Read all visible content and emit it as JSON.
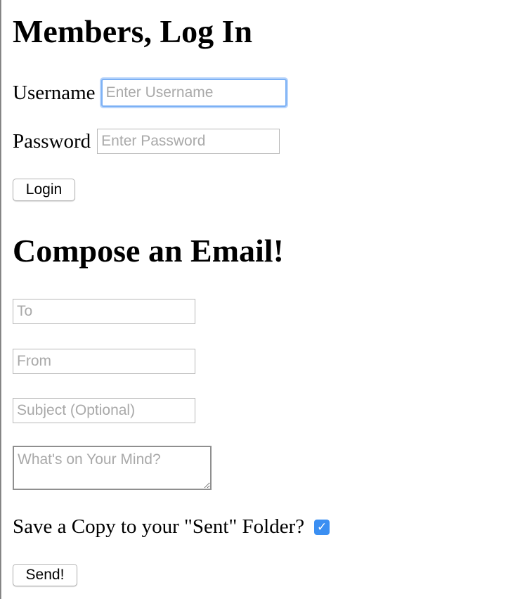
{
  "login": {
    "title": "Members, Log In",
    "username_label": "Username",
    "username_placeholder": "Enter Username",
    "password_label": "Password",
    "password_placeholder": "Enter Password",
    "login_button": "Login"
  },
  "compose": {
    "title": "Compose an Email!",
    "to_placeholder": "To",
    "from_placeholder": "From",
    "subject_placeholder": "Subject (Optional)",
    "message_placeholder": "What's on Your Mind?",
    "save_copy_label": "Save a Copy to your \"Sent\" Folder?",
    "save_copy_checked": true,
    "send_button": "Send!"
  },
  "colors": {
    "focus_ring": "#7cb1f5",
    "checkbox": "#3b8ff2"
  }
}
